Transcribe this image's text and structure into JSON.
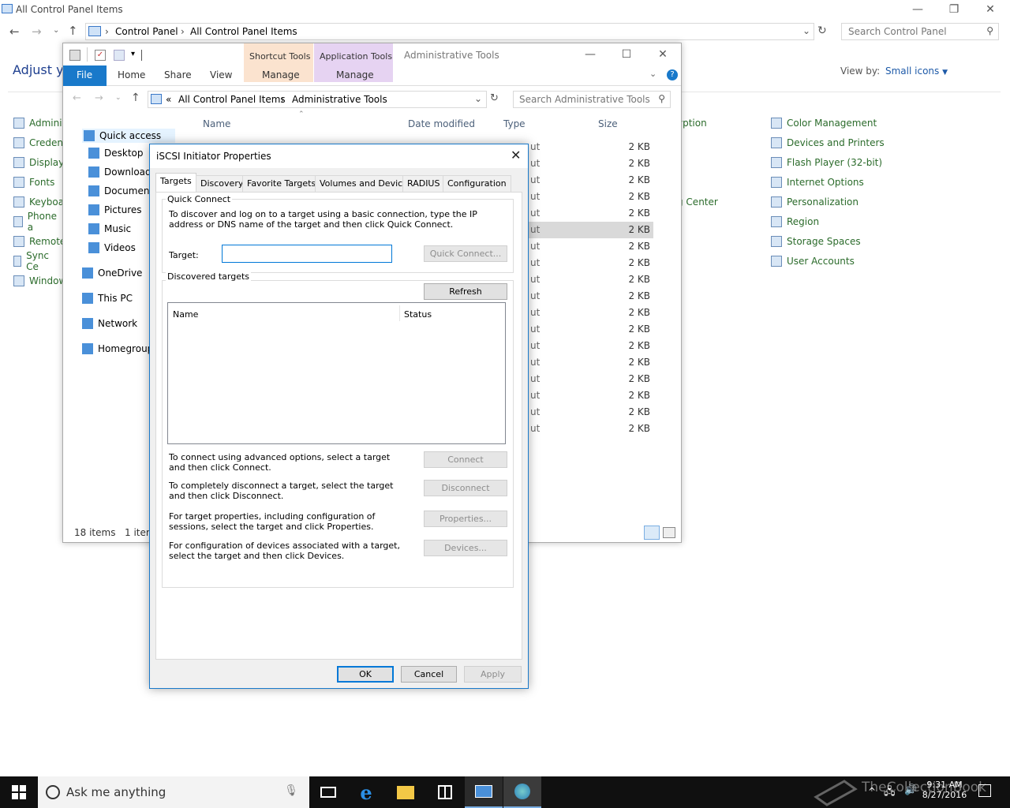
{
  "control_panel": {
    "title": "All Control Panel Items",
    "breadcrumb": [
      "Control Panel",
      "All Control Panel Items"
    ],
    "search_placeholder": "Search Control Panel",
    "heading": "Adjust yo",
    "view_by_label": "View by:",
    "view_by_value": "Small icons",
    "left_items": [
      "Admini",
      "Credent",
      "Display",
      "Fonts",
      "Keyboar",
      "Phone a",
      "Remote",
      "Sync Ce",
      "Window"
    ],
    "mid_items": [
      {
        "text": "yption",
        "row": 0
      },
      {
        "text": "g Center",
        "row": 4
      }
    ],
    "right_items": [
      "Color Management",
      "Devices and Printers",
      "Flash Player (32-bit)",
      "Internet Options",
      "Personalization",
      "Region",
      "Storage Spaces",
      "User Accounts"
    ]
  },
  "explorer": {
    "title": "Administrative Tools",
    "contextual_tabs": [
      {
        "label": "Shortcut Tools",
        "sub": "Manage",
        "color": "#fbe3cf"
      },
      {
        "label": "Application Tools",
        "sub": "Manage",
        "color": "#e6d3f2"
      }
    ],
    "ribbon_tabs": [
      "File",
      "Home",
      "Share",
      "View"
    ],
    "breadcrumb": [
      "«",
      "All Control Panel Items",
      "Administrative Tools"
    ],
    "search_placeholder": "Search Administrative Tools",
    "nav": [
      "Quick access",
      "Desktop",
      "Downloads",
      "Documents",
      "Pictures",
      "Music",
      "Videos",
      "OneDrive",
      "This PC",
      "Network",
      "Homegroup"
    ],
    "columns": [
      "Name",
      "Date modified",
      "Type",
      "Size"
    ],
    "type_fragments": [
      "ut",
      "ut",
      "ut",
      "ut",
      "ut",
      "ut",
      "ut",
      "ut",
      "ut",
      "ut",
      "ut",
      "ut",
      "ut",
      "ut",
      "ut",
      "ut",
      "ut",
      "ut"
    ],
    "sizes": [
      "2 KB",
      "2 KB",
      "2 KB",
      "2 KB",
      "2 KB",
      "2 KB",
      "2 KB",
      "2 KB",
      "2 KB",
      "2 KB",
      "2 KB",
      "2 KB",
      "2 KB",
      "2 KB",
      "2 KB",
      "2 KB",
      "2 KB",
      "2 KB"
    ],
    "status_items": "18 items",
    "status_selected": "1 item"
  },
  "dialog": {
    "title": "iSCSI Initiator Properties",
    "tabs": [
      "Targets",
      "Discovery",
      "Favorite Targets",
      "Volumes and Devices",
      "RADIUS",
      "Configuration"
    ],
    "quick_connect": {
      "label": "Quick Connect",
      "desc": "To discover and log on to a target using a basic connection, type the IP address or DNS name of the target and then click Quick Connect.",
      "target_label": "Target:",
      "target_value": "",
      "button": "Quick Connect..."
    },
    "discovered": {
      "label": "Discovered targets",
      "refresh": "Refresh",
      "columns": [
        "Name",
        "Status"
      ]
    },
    "actions": [
      {
        "text": "To connect using advanced options, select a target and then click Connect.",
        "button": "Connect"
      },
      {
        "text": "To completely disconnect a target, select the target and then click Disconnect.",
        "button": "Disconnect"
      },
      {
        "text": "For target properties, including configuration of sessions, select the target and click Properties.",
        "button": "Properties..."
      },
      {
        "text": "For configuration of devices associated with a target, select the target and then click Devices.",
        "button": "Devices..."
      }
    ],
    "ok": "OK",
    "cancel": "Cancel",
    "apply": "Apply"
  },
  "taskbar": {
    "search_placeholder": "Ask me anything",
    "time": "9:31 AM",
    "date": "8/27/2016",
    "watermark": "TheCollectionBook"
  }
}
